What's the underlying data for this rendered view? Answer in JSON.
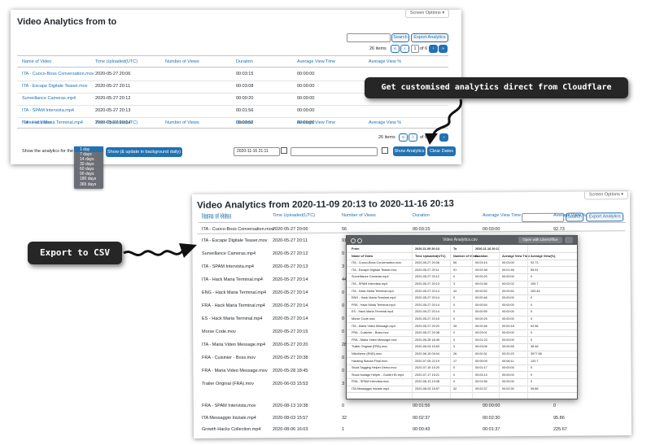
{
  "panel1": {
    "title": "Video Analytics from to",
    "screen_options": "Screen Options ▾",
    "search_btn": "Search",
    "export_btn": "Export Analytics",
    "pagination": {
      "items": "26 items",
      "first": "«",
      "prev": "‹",
      "page": "1",
      "of": "of 6",
      "next": "›",
      "last": "»"
    },
    "bottom_pagination": {
      "items": "26 items",
      "first": "«",
      "prev": "‹",
      "page": "1",
      "of": "of 6",
      "next": "›",
      "last": "»"
    },
    "columns": [
      "Name of Video",
      "Time Uploaded(UTC)",
      "Number of Views",
      "Duration",
      "Average View Time",
      "Average View %"
    ],
    "rows": [
      {
        "name": "ITA - Cuoco-Boss Conversation.mov",
        "time": "2020-05-27 20:06",
        "views": "",
        "duration": "00:03:15",
        "avg": "00:00:00",
        "pct": ""
      },
      {
        "name": "ITA - Escape Digitale Teaser.mov",
        "time": "2020-05-27 20:11",
        "views": "",
        "duration": "00:03:08",
        "avg": "00:00:00",
        "pct": ""
      },
      {
        "name": "Surveillance Cameras.mp4",
        "time": "2020-05-27 20:12",
        "views": "",
        "duration": "00:00:20",
        "avg": "00:00:00",
        "pct": ""
      },
      {
        "name": "ITA - SPAM Intervista.mp4",
        "time": "2020-05-27 20:13",
        "views": "",
        "duration": "00:01:56",
        "avg": "00:00:00",
        "pct": ""
      },
      {
        "name": "ITA - Hack Maria Terminal.mp4",
        "time": "2020-05-27 20:14",
        "views": "",
        "duration": "00:00:52",
        "avg": "00:00:00",
        "pct": ""
      }
    ],
    "show_label": "Show the analytics for the past",
    "dropdown_options": [
      "1 day",
      "7 days",
      "14 days",
      "30 days",
      "60 days",
      "90 days",
      "180 days",
      "365 days"
    ],
    "update_btn": "Show (& update in background daily)",
    "date_from": "2020-11-16 21:11",
    "date_to": "",
    "show_analytics_btn": "Show Analytics",
    "clear_dates_btn": "Clear Dates"
  },
  "panel2": {
    "title": "Video Analytics from 2020-11-09 20:13 to 2020-11-16 20:13",
    "screen_options": "Screen Options ▾",
    "search_btn": "Search",
    "export_btn": "Export Analytics",
    "columns": [
      "Name of Video",
      "Time Uploaded(UTC)",
      "Number of Views",
      "Duration",
      "Average View Time",
      "Average View %"
    ],
    "rows": [
      {
        "name": "ITA - Cuoco-Boss Conversation.mov",
        "time": "2020-05-27 20:06",
        "views": "56",
        "duration": "00:03:15",
        "avg": "00:03:00",
        "pct": "92.73"
      },
      {
        "name": "ITA - Escape Digitale Teaser.mov",
        "time": "2020-05-27 20:11",
        "views": "91",
        "duration": "00:02:38",
        "avg": "",
        "pct": ""
      },
      {
        "name": "Surveillance Cameras.mp4",
        "time": "2020-05-27 20:12",
        "views": "0",
        "duration": "",
        "avg": "",
        "pct": ""
      },
      {
        "name": "ITA - SPAM Intervista.mp4",
        "time": "2020-05-27 20:13",
        "views": "3",
        "duration": "",
        "avg": "",
        "pct": ""
      },
      {
        "name": "ITA - Hack Maria Terminal.mp4",
        "time": "2020-05-27 20:14",
        "views": "44",
        "duration": "",
        "avg": "",
        "pct": ""
      },
      {
        "name": "ENG - Hack Maria Terminal.mp4",
        "time": "2020-05-27 20:14",
        "views": "0",
        "duration": "",
        "avg": "",
        "pct": ""
      },
      {
        "name": "FRA - Hack Maria Terminal.mp4",
        "time": "2020-05-27 20:14",
        "views": "0",
        "duration": "",
        "avg": "",
        "pct": ""
      },
      {
        "name": "ES - Hack Maria Terminal.mp4",
        "time": "2020-05-27 20:14",
        "views": "0",
        "duration": "",
        "avg": "",
        "pct": ""
      },
      {
        "name": "Morse Code.mov",
        "time": "2020-05-27 20:15",
        "views": "0",
        "duration": "",
        "avg": "",
        "pct": ""
      },
      {
        "name": "ITA - Maria Video Message.mp4",
        "time": "2020-05-27 20:20",
        "views": "28",
        "duration": "",
        "avg": "",
        "pct": ""
      },
      {
        "name": "FRA - Cuisinier - Boss.mov",
        "time": "2020-05-27 20:38",
        "views": "0",
        "duration": "",
        "avg": "",
        "pct": ""
      },
      {
        "name": "FRA - Maria Video Message.mov",
        "time": "2020-05-28 18:45",
        "views": "0",
        "duration": "",
        "avg": "",
        "pct": ""
      },
      {
        "name": "Trailer Original (FRA).mov",
        "time": "2020-06-03 15:53",
        "views": "3",
        "duration": "",
        "avg": "",
        "pct": ""
      },
      {
        "name": "Nikotherm (END).mov",
        "time": "2020-06-15 09:04",
        "views": "26",
        "duration": "",
        "avg": "",
        "pct": ""
      },
      {
        "name": "Hacking Stanza Final.mov",
        "time": "2020-07-05 22:19",
        "views": "17",
        "duration": "",
        "avg": "",
        "pct": ""
      },
      {
        "name": "Stock Tagging Helper Demo.mov",
        "time": "2020-07-15 15:20",
        "views": "0",
        "duration": "",
        "avg": "",
        "pct": ""
      },
      {
        "name": "Stock footage Helper - Guide-HD.mp4",
        "time": "2020-07-17 15:21",
        "views": "0",
        "duration": "",
        "avg": "",
        "pct": ""
      },
      {
        "name": "FRA - SPAM Intervista.mov",
        "time": "2020-08-13 19:38",
        "views": "0",
        "duration": "00:01:56",
        "avg": "00:00:00",
        "pct": "0"
      },
      {
        "name": "ITA Messaggio Iniziale.mp4",
        "time": "2020-08-03 15:57",
        "views": "32",
        "duration": "00:02:37",
        "avg": "00:02:30",
        "pct": "95.86"
      },
      {
        "name": "Growth Hacks Collection.mp4",
        "time": "2020-08-06 16:03",
        "views": "1",
        "duration": "00:00:43",
        "avg": "00:01:37",
        "pct": "225.67"
      }
    ]
  },
  "csv_window": {
    "title": "Video Analytics.csv",
    "open_btn": "Open with LibreOffice",
    "header_row1": [
      "From",
      "2020-11-09 20:13",
      "To",
      "2020-11-16 20:13",
      "",
      ""
    ],
    "columns": [
      "Name of Video",
      "Time Uploaded(UTC)",
      "Number of Views",
      "Duration",
      "Average View Time",
      "Average View(%)"
    ],
    "rows": [
      [
        "ITA - Cuoco-Boss Conversation.mov",
        "2020-05-27 20:06",
        "56",
        "00:03:15",
        "00:03:00",
        "92.73"
      ],
      [
        "ITA - Escape Digitale Teaser.mov",
        "2020-05-27 20:11",
        "91",
        "00:02:38",
        "00:01:46",
        "55.91"
      ],
      [
        "Surveillance Cameras.mp4",
        "2020-05-27 20:12",
        "0",
        "00:00:20",
        "00:00:00",
        "0"
      ],
      [
        "ITA - SPAM Intervista.mp4",
        "2020-05-27 20:13",
        "3",
        "00:01:56",
        "00:02:02",
        "105.7"
      ],
      [
        "ITA - Hack Maria Terminal.mp4",
        "2020-05-27 20:14",
        "44",
        "00:00:52",
        "00:00:52",
        "100.45"
      ],
      [
        "ENG - Hack Maria Terminal.mp4",
        "2020-05-27 20:14",
        "0",
        "00:00:46",
        "00:00:00",
        "0"
      ],
      [
        "FRA - Hack Maria Terminal.mp4",
        "2020-05-27 20:14",
        "0",
        "00:00:54",
        "00:00:00",
        "0"
      ],
      [
        "ES - Hack Maria Terminal.mp4",
        "2020-05-27 20:14",
        "0",
        "00:00:55",
        "00:00:00",
        "0"
      ],
      [
        "Morse Code.mov",
        "2020-05-27 20:15",
        "0",
        "00:00:25",
        "00:00:00",
        "0"
      ],
      [
        "ITA - Maria Video Message.mp4",
        "2020-05-27 20:20",
        "28",
        "00:00:46",
        "00:00:18",
        "92.56"
      ],
      [
        "FRA - Cuisinier - Boss.mov",
        "2020-05-27 20:38",
        "0",
        "00:03:01",
        "00:00:00",
        "0"
      ],
      [
        "FRA - Maria Video Message.mov",
        "2020-05-28 18:45",
        "0",
        "00:01:23",
        "00:00:00",
        "0"
      ],
      [
        "Trailer Original (FRA).mov",
        "2020-06-03 15:53",
        "3",
        "00:03:06",
        "00:00:55",
        "35.46"
      ],
      [
        "Nikotherm (END).mov",
        "2020-06-15 09:04",
        "26",
        "00:00:31",
        "00:20:23",
        "3977.68"
      ],
      [
        "Hacking Stanza Final.mov",
        "2020-07-05 22:19",
        "17",
        "00:05:09",
        "00:06:11",
        "120.7"
      ],
      [
        "Stock Tagging Helper Demo.mov",
        "2020-07-15 15:20",
        "0",
        "00:01:17",
        "00:00:00",
        "0"
      ],
      [
        "Stock footage Helper - Guide-HD.mp4",
        "2020-07-17 15:21",
        "0",
        "00:03:13",
        "00:00:00",
        "0"
      ],
      [
        "FRA - SPAM Intervista.mov",
        "2020-08-13 19:38",
        "0",
        "00:01:56",
        "00:00:00",
        "0"
      ],
      [
        "ITA Messaggio Iniziale.mp4",
        "2020-08-03 15:57",
        "32",
        "00:02:37",
        "00:02:30",
        "95.86"
      ]
    ]
  },
  "callouts": {
    "cloudflare": "Get customised analytics direct from Cloudflare",
    "csv": "Export to CSV"
  }
}
